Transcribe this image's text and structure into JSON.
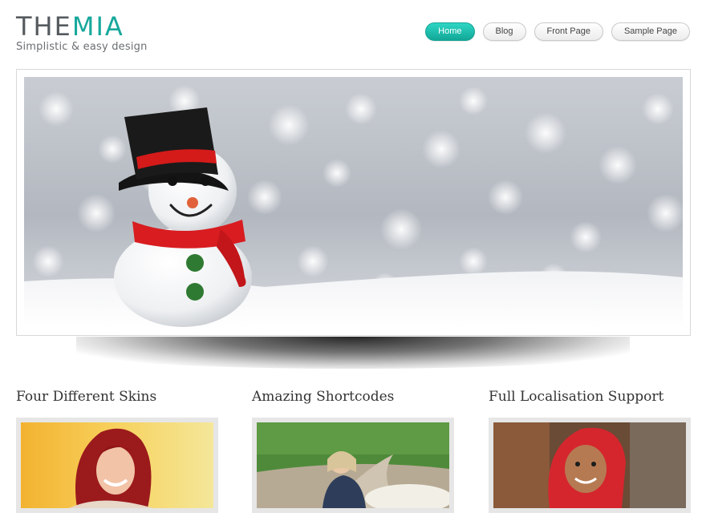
{
  "site": {
    "logo_part1": "THE",
    "logo_part2": "MIA",
    "tagline": "Simplistic & easy design"
  },
  "nav": {
    "items": [
      {
        "label": "Home",
        "active": true
      },
      {
        "label": "Blog",
        "active": false
      },
      {
        "label": "Front Page",
        "active": false
      },
      {
        "label": "Sample Page",
        "active": false
      }
    ]
  },
  "hero": {
    "image": "snowman-in-snow"
  },
  "features": [
    {
      "title": "Four Different Skins",
      "image": "red-haired-woman"
    },
    {
      "title": "Amazing Shortcodes",
      "image": "girl-on-path"
    },
    {
      "title": "Full Localisation Support",
      "image": "child-in-red-hood"
    }
  ],
  "colors": {
    "accent": "#17a89c",
    "logo_dark": "#555a5e"
  }
}
